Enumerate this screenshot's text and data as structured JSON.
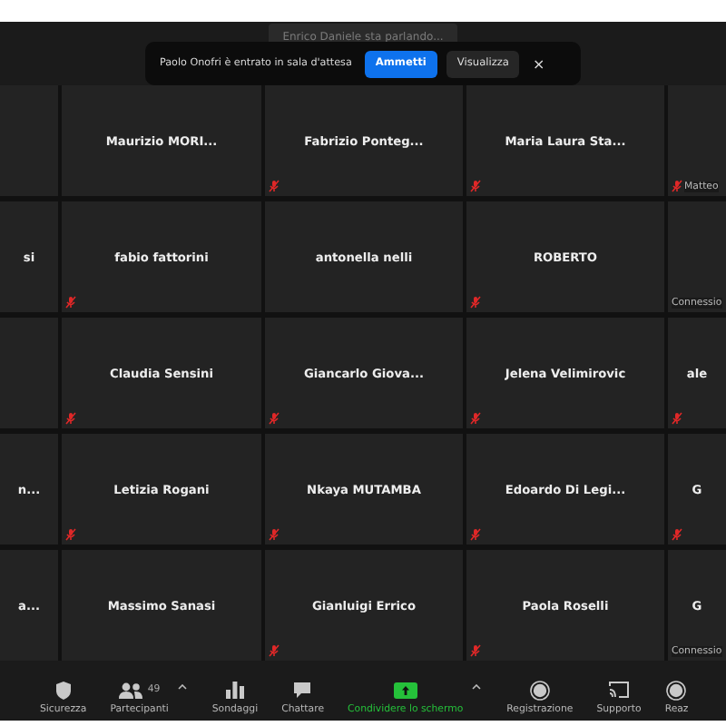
{
  "speaking_indicator": "Enrico Daniele sta parlando...",
  "notification": {
    "message": "Paolo Onofri è entrato in sala d'attesa",
    "close": "×",
    "buttons": [
      {
        "label": "Ammetti",
        "kind": "primary"
      },
      {
        "label": "Visualizza",
        "kind": "secondary"
      }
    ]
  },
  "grid": [
    [
      {
        "muted": false
      },
      {
        "name": "Maurizio MORI...",
        "muted": false
      },
      {
        "name": "Fabrizio Ponteg...",
        "muted": true
      },
      {
        "name": "Maria Laura Sta...",
        "muted": true
      },
      {
        "footer": "Matteo",
        "muted": true
      }
    ],
    [
      {
        "name": "si",
        "muted": false
      },
      {
        "name": "fabio fattorini",
        "muted": true
      },
      {
        "name": "antonella nelli",
        "muted": false
      },
      {
        "name": "ROBERTO",
        "muted": true
      },
      {
        "footer": "Connessio",
        "muted": false
      }
    ],
    [
      {
        "muted": false
      },
      {
        "name": "Claudia Sensini",
        "muted": true
      },
      {
        "name": "Giancarlo Giova...",
        "muted": true
      },
      {
        "name": "Jelena Velimirovic",
        "muted": true
      },
      {
        "name": "ale",
        "muted": true
      }
    ],
    [
      {
        "name": "n...",
        "muted": false
      },
      {
        "name": "Letizia Rogani",
        "muted": true
      },
      {
        "name": "Nkaya MUTAMBA",
        "muted": true
      },
      {
        "name": "Edoardo Di Legi...",
        "muted": true
      },
      {
        "name": "G",
        "muted": true
      }
    ],
    [
      {
        "name": "a...",
        "muted": false
      },
      {
        "name": "Massimo Sanasi",
        "muted": false
      },
      {
        "name": "Gianluigi Errico",
        "muted": true
      },
      {
        "name": "Paola Roselli",
        "muted": true
      },
      {
        "name": "G",
        "footer": "Connessio",
        "muted": false
      }
    ]
  ],
  "toolbar": [
    {
      "label": "Sicurezza",
      "kind": "shield",
      "caret": false
    },
    {
      "label": "Partecipanti",
      "kind": "people",
      "badge": "49",
      "caret": true
    },
    {
      "label": "Sondaggi",
      "kind": "bars",
      "caret": false
    },
    {
      "label": "Chattare",
      "kind": "chat",
      "caret": false
    },
    {
      "label": "Condividere lo schermo",
      "kind": "share",
      "caret": true,
      "active": true
    },
    {
      "label": "Registrazione",
      "kind": "record",
      "caret": false
    },
    {
      "label": "Supporto",
      "kind": "cast",
      "caret": false
    },
    {
      "label": "Reaz",
      "kind": "record",
      "caret": false
    }
  ]
}
